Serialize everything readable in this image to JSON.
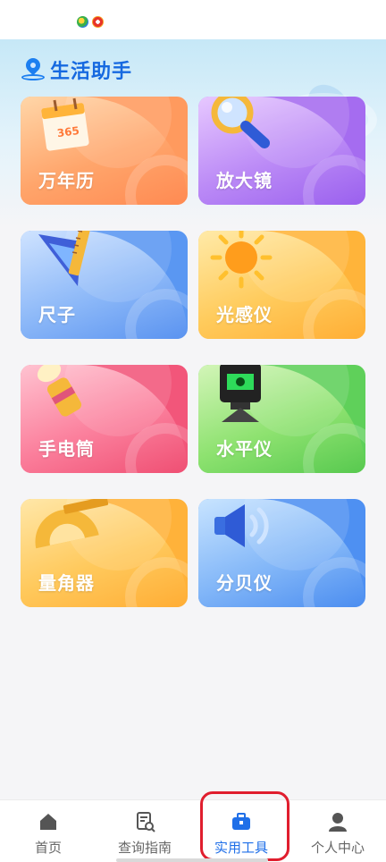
{
  "status_bar": {
    "icons": [
      "app-notification-icon",
      "weibo-notification-icon"
    ]
  },
  "header": {
    "title": "生活助手",
    "icon": "location-pin-icon"
  },
  "tools": [
    {
      "label": "万年历",
      "icon": "calendar-icon",
      "color": "#ff9a5e"
    },
    {
      "label": "放大镜",
      "icon": "magnifier-icon",
      "color": "#a56cf0"
    },
    {
      "label": "尺子",
      "icon": "ruler-icon",
      "color": "#5a97f2"
    },
    {
      "label": "光感仪",
      "icon": "sun-icon",
      "color": "#ffb43a"
    },
    {
      "label": "手电筒",
      "icon": "flashlight-icon",
      "color": "#f2567a"
    },
    {
      "label": "水平仪",
      "icon": "laser-level-icon",
      "color": "#5fd05a"
    },
    {
      "label": "量角器",
      "icon": "protractor-icon",
      "color": "#ffb23a"
    },
    {
      "label": "分贝仪",
      "icon": "speaker-icon",
      "color": "#4e90f2"
    }
  ],
  "bottom_nav": {
    "items": [
      {
        "label": "首页",
        "icon": "home-icon",
        "active": false
      },
      {
        "label": "查询指南",
        "icon": "document-search-icon",
        "active": false
      },
      {
        "label": "实用工具",
        "icon": "toolbox-icon",
        "active": true
      },
      {
        "label": "个人中心",
        "icon": "person-icon",
        "active": false
      }
    ],
    "active_color": "#1f6fe8",
    "highlight_color": "#e01e2e"
  }
}
